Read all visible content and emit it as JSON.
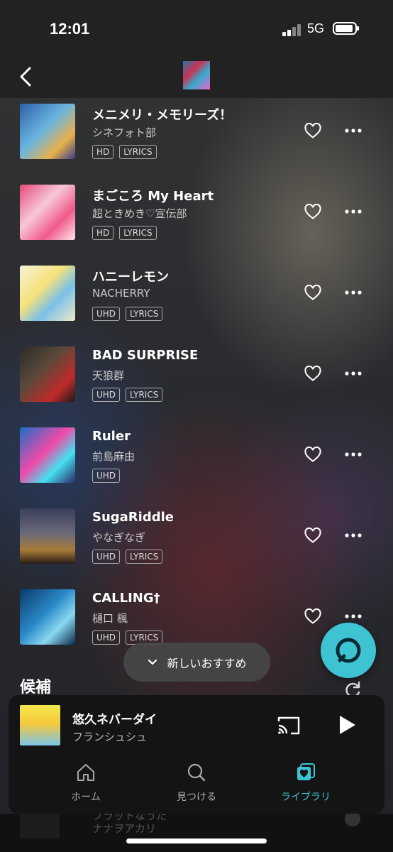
{
  "status": {
    "time": "12:01",
    "network": "5G"
  },
  "tracks": [
    {
      "title": "メニメリ・メモリーズ！",
      "artist": "シネフォト部",
      "tags": [
        "HD",
        "LYRICS"
      ]
    },
    {
      "title": "まごころ My Heart",
      "artist": "超ときめき♡宣伝部",
      "tags": [
        "HD",
        "LYRICS"
      ]
    },
    {
      "title": "ハニーレモン",
      "artist": "NACHERRY",
      "tags": [
        "UHD",
        "LYRICS"
      ]
    },
    {
      "title": "BAD SURPRISE",
      "artist": "天狼群",
      "tags": [
        "UHD",
        "LYRICS"
      ]
    },
    {
      "title": "Ruler",
      "artist": "前島麻由",
      "tags": [
        "UHD"
      ]
    },
    {
      "title": "SugaRiddle",
      "artist": "やなぎなぎ",
      "tags": [
        "UHD",
        "LYRICS"
      ]
    },
    {
      "title": "CALLING†",
      "artist": "樋口 楓",
      "tags": [
        "UHD",
        "LYRICS"
      ]
    }
  ],
  "recommend_pill": {
    "label": "新しいおすすめ"
  },
  "section": {
    "title": "候補"
  },
  "next_row": {
    "title": "フラットなうた",
    "artist": "ナナヲアカリ"
  },
  "now_playing": {
    "title": "悠久ネバーダイ",
    "artist": "フランシュシュ"
  },
  "tabs": [
    {
      "label": "ホーム",
      "icon": "home-icon"
    },
    {
      "label": "見つける",
      "icon": "search-icon"
    },
    {
      "label": "ライブラリ",
      "icon": "library-icon",
      "active": true
    }
  ],
  "colors": {
    "accent": "#3ec3d3"
  }
}
